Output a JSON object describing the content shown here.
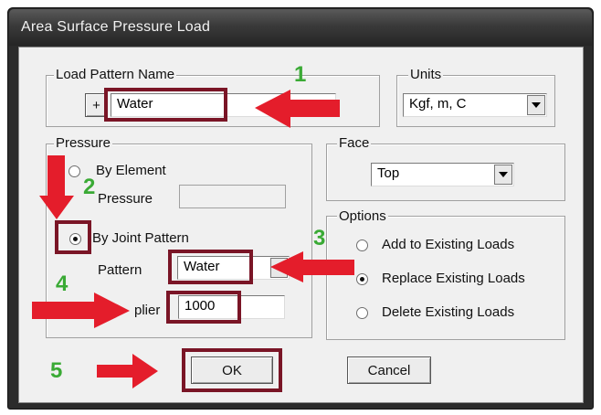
{
  "window": {
    "title": "Area Surface Pressure Load"
  },
  "load_pattern": {
    "legend": "Load Pattern Name",
    "add_button": "+",
    "value": "Water"
  },
  "units": {
    "legend": "Units",
    "value": "Kgf, m, C"
  },
  "pressure": {
    "legend": "Pressure",
    "by_element_label": "By Element",
    "pressure_label": "Pressure",
    "pressure_value": "",
    "by_joint_pattern_label": "By Joint Pattern",
    "pattern_label": "Pattern",
    "pattern_value": "Water",
    "multiplier_label_visible": "plier",
    "multiplier_value": "1000",
    "selected": "By Joint Pattern"
  },
  "face": {
    "legend": "Face",
    "value": "Top"
  },
  "options": {
    "legend": "Options",
    "items": [
      "Add to Existing Loads",
      "Replace Existing Loads",
      "Delete Existing Loads"
    ],
    "selected": "Replace Existing Loads"
  },
  "buttons": {
    "ok": "OK",
    "cancel": "Cancel"
  },
  "annotations": {
    "steps": [
      "1",
      "2",
      "3",
      "4",
      "5"
    ],
    "arrow_color": "#e41d2b",
    "step_color": "#3aaa35",
    "highlight_color": "#7a1526"
  }
}
